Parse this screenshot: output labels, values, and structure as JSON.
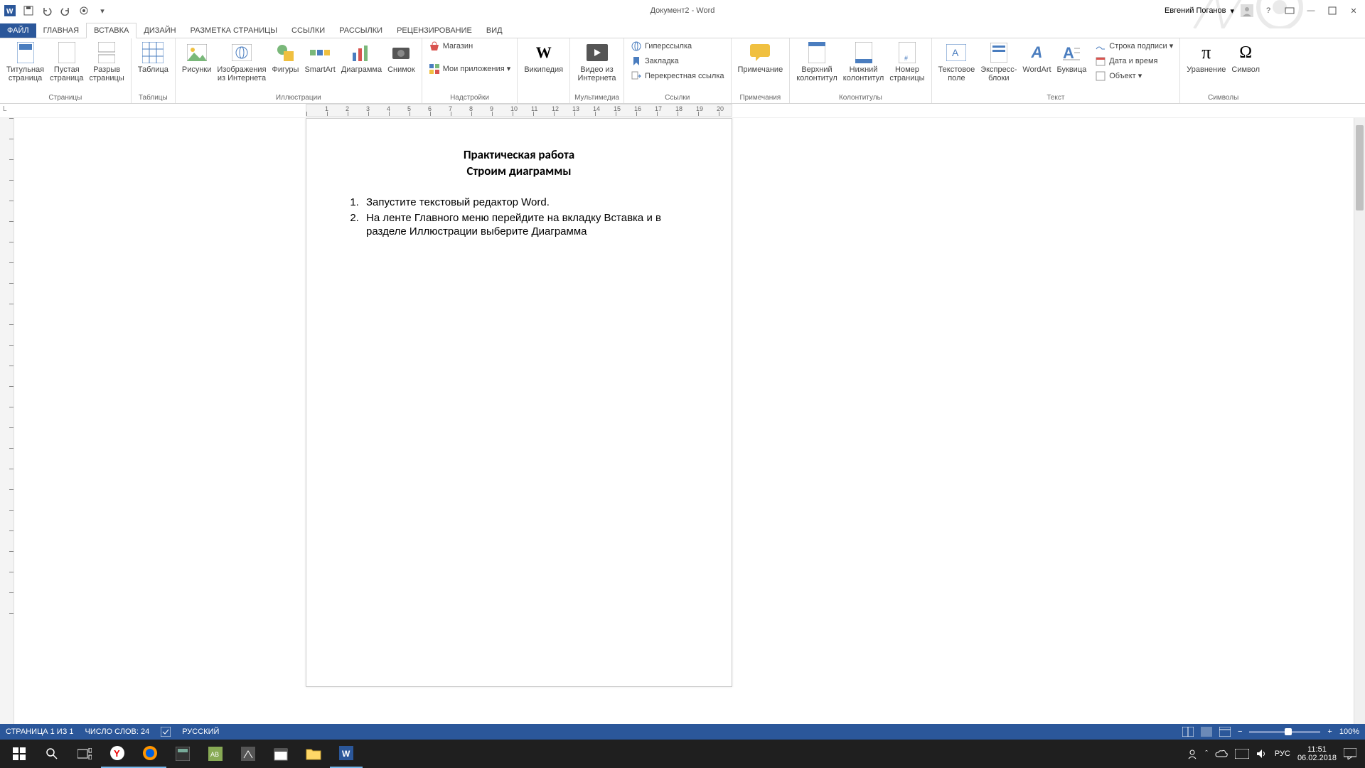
{
  "app": {
    "title": "Документ2 - Word",
    "user": "Евгений Поганов"
  },
  "qat": [
    "word",
    "save",
    "undo",
    "redo",
    "touch"
  ],
  "tabs": [
    {
      "id": "file",
      "label": "ФАЙЛ"
    },
    {
      "id": "home",
      "label": "ГЛАВНАЯ"
    },
    {
      "id": "insert",
      "label": "ВСТАВКА",
      "active": true
    },
    {
      "id": "design",
      "label": "ДИЗАЙН"
    },
    {
      "id": "layout",
      "label": "РАЗМЕТКА СТРАНИЦЫ"
    },
    {
      "id": "refs",
      "label": "ССЫЛКИ"
    },
    {
      "id": "mail",
      "label": "РАССЫЛКИ"
    },
    {
      "id": "review",
      "label": "РЕЦЕНЗИРОВАНИЕ"
    },
    {
      "id": "view",
      "label": "ВИД"
    }
  ],
  "ribbon": {
    "pages": {
      "label": "Страницы",
      "items": [
        "Титульная\nстраница",
        "Пустая\nстраница",
        "Разрыв\nстраницы"
      ]
    },
    "tables": {
      "label": "Таблицы",
      "items": [
        "Таблица"
      ]
    },
    "illus": {
      "label": "Иллюстрации",
      "items": [
        "Рисунки",
        "Изображения\nиз Интернета",
        "Фигуры",
        "SmartArt",
        "Диаграмма",
        "Снимок"
      ]
    },
    "addins": {
      "label": "Надстройки",
      "store": "Магазин",
      "myapps": "Мои приложения"
    },
    "wiki": {
      "label": "Википедия"
    },
    "media": {
      "label": "Мультимедиа",
      "items": [
        "Видео из\nИнтернета"
      ]
    },
    "links": {
      "label": "Ссылки",
      "items": [
        "Гиперссылка",
        "Закладка",
        "Перекрестная ссылка"
      ]
    },
    "comments": {
      "label": "Примечания",
      "items": [
        "Примечание"
      ]
    },
    "headers": {
      "label": "Колонтитулы",
      "items": [
        "Верхний\nколонтитул",
        "Нижний\nколонтитул",
        "Номер\nстраницы"
      ]
    },
    "text": {
      "label": "Текст",
      "items": [
        "Текстовое\nполе",
        "Экспресс-\nблоки",
        "WordArt",
        "Буквица"
      ],
      "extra": [
        "Строка подписи",
        "Дата и время",
        "Объект"
      ]
    },
    "symbols": {
      "label": "Символы",
      "items": [
        "Уравнение",
        "Символ"
      ]
    }
  },
  "document": {
    "title1": "Практическая работа",
    "title2": "Строим диаграммы",
    "items": [
      "Запустите текстовый редактор Word.",
      "На ленте Главного меню перейдите на вкладку Вставка и в разделе Иллюстрации выберите Диаграмма"
    ]
  },
  "statusbar": {
    "page": "СТРАНИЦА 1 ИЗ 1",
    "words": "ЧИСЛО СЛОВ: 24",
    "lang": "РУССКИЙ",
    "zoom": "100%"
  },
  "taskbar": {
    "time": "11:51",
    "date": "06.02.2018",
    "lang": "РУС"
  }
}
